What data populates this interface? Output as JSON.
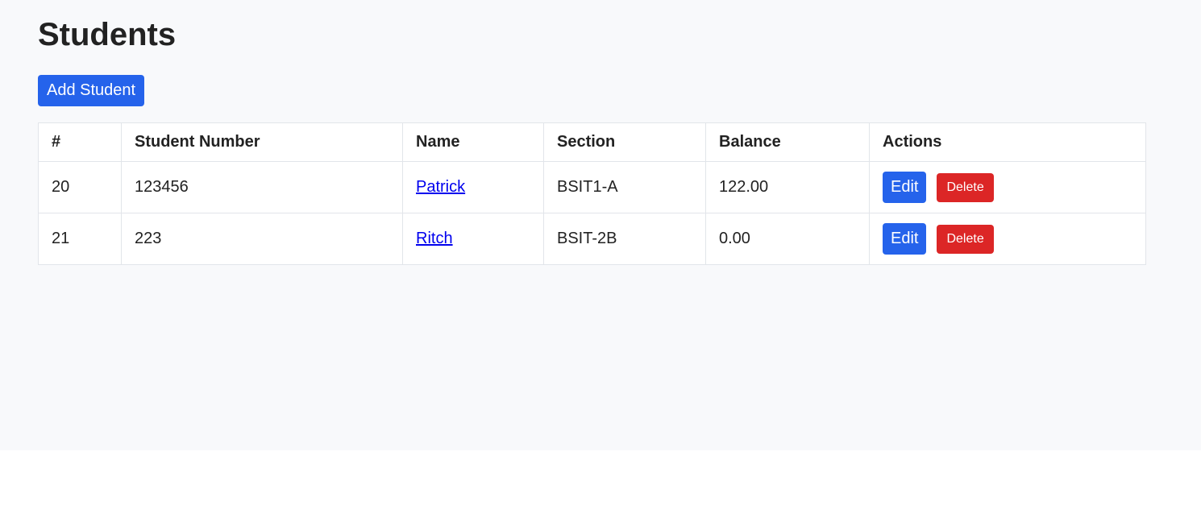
{
  "page": {
    "title": "Students",
    "add_button_label": "Add Student"
  },
  "table": {
    "headers": [
      "#",
      "Student Number",
      "Name",
      "Section",
      "Balance",
      "Actions"
    ],
    "rows": [
      {
        "id": "20",
        "student_number": "123456",
        "name": "Patrick",
        "section": "BSIT1-A",
        "balance": "122.00"
      },
      {
        "id": "21",
        "student_number": "223",
        "name": "Ritch",
        "section": "BSIT-2B",
        "balance": "0.00"
      }
    ],
    "edit_label": "Edit",
    "delete_label": "Delete"
  },
  "colors": {
    "primary": "#2563eb",
    "danger": "#dc2626",
    "link": "#0000ee",
    "background": "#f8f9fb"
  }
}
